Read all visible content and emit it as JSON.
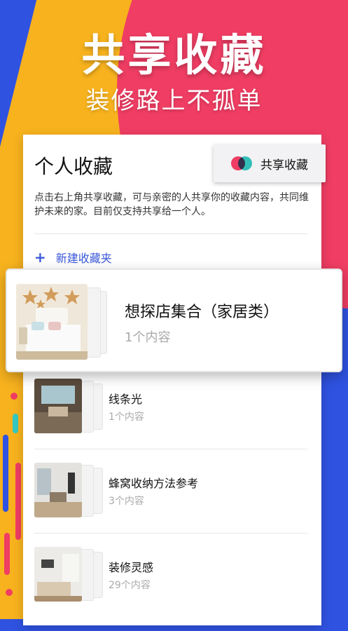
{
  "hero": {
    "title": "共享收藏",
    "subtitle": "装修路上不孤单"
  },
  "card": {
    "title": "个人收藏",
    "share_button_label": "共享收藏",
    "description": "点击右上角共享收藏，可与亲密的人共享你的收藏内容，共同维护未来的家。目前仅支持共享给一个人。",
    "new_folder_label": "新建收藏夹",
    "new_folder_icon": "plus-icon"
  },
  "highlight": {
    "title": "想探店集合（家居类）",
    "count": "1个内容"
  },
  "folders": [
    {
      "title": "线条光",
      "count": "1个内容"
    },
    {
      "title": "蜂窝收纳方法参考",
      "count": "3个内容"
    },
    {
      "title": "装修灵感",
      "count": "29个内容"
    }
  ],
  "colors": {
    "accent_blue": "#3a58d8",
    "brand_pink": "#ef3d63",
    "brand_teal": "#35c9c1",
    "brand_yellow": "#f7b21e",
    "background_blue": "#2f52e0"
  }
}
